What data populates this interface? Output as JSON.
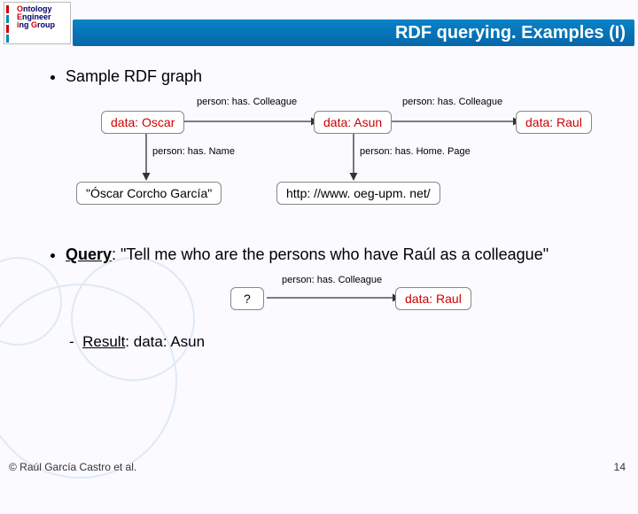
{
  "logo": {
    "line1a": "O",
    "line1b": "ntology",
    "line2a": "E",
    "line2b": "ngineer",
    "line3a": "i",
    "line3b": "ng ",
    "line3c": "G",
    "line3d": "roup"
  },
  "title": "RDF querying. Examples (I)",
  "bullet1": "Sample RDF graph",
  "graph": {
    "nodes": {
      "oscar": "data: Oscar",
      "asun": "data: Asun",
      "raul": "data: Raul",
      "oscar_name": "\"Óscar Corcho García\"",
      "asun_page": "http: //www. oeg-upm. net/"
    },
    "edges": {
      "has_colleague1": "person: has. Colleague",
      "has_colleague2": "person: has. Colleague",
      "has_name": "person: has. Name",
      "has_homepage": "person: has. Home. Page"
    }
  },
  "query": {
    "label": "Query",
    "text": ": \"Tell me who are the persons who have Raúl as a colleague\"",
    "unknown_node": "?",
    "target_node": "data: Raul",
    "edge": "person: has. Colleague",
    "result_label": "Result",
    "result_value": ": data: Asun"
  },
  "footer": {
    "copyright": "© Raúl García Castro et al.",
    "pagenum": "14"
  }
}
